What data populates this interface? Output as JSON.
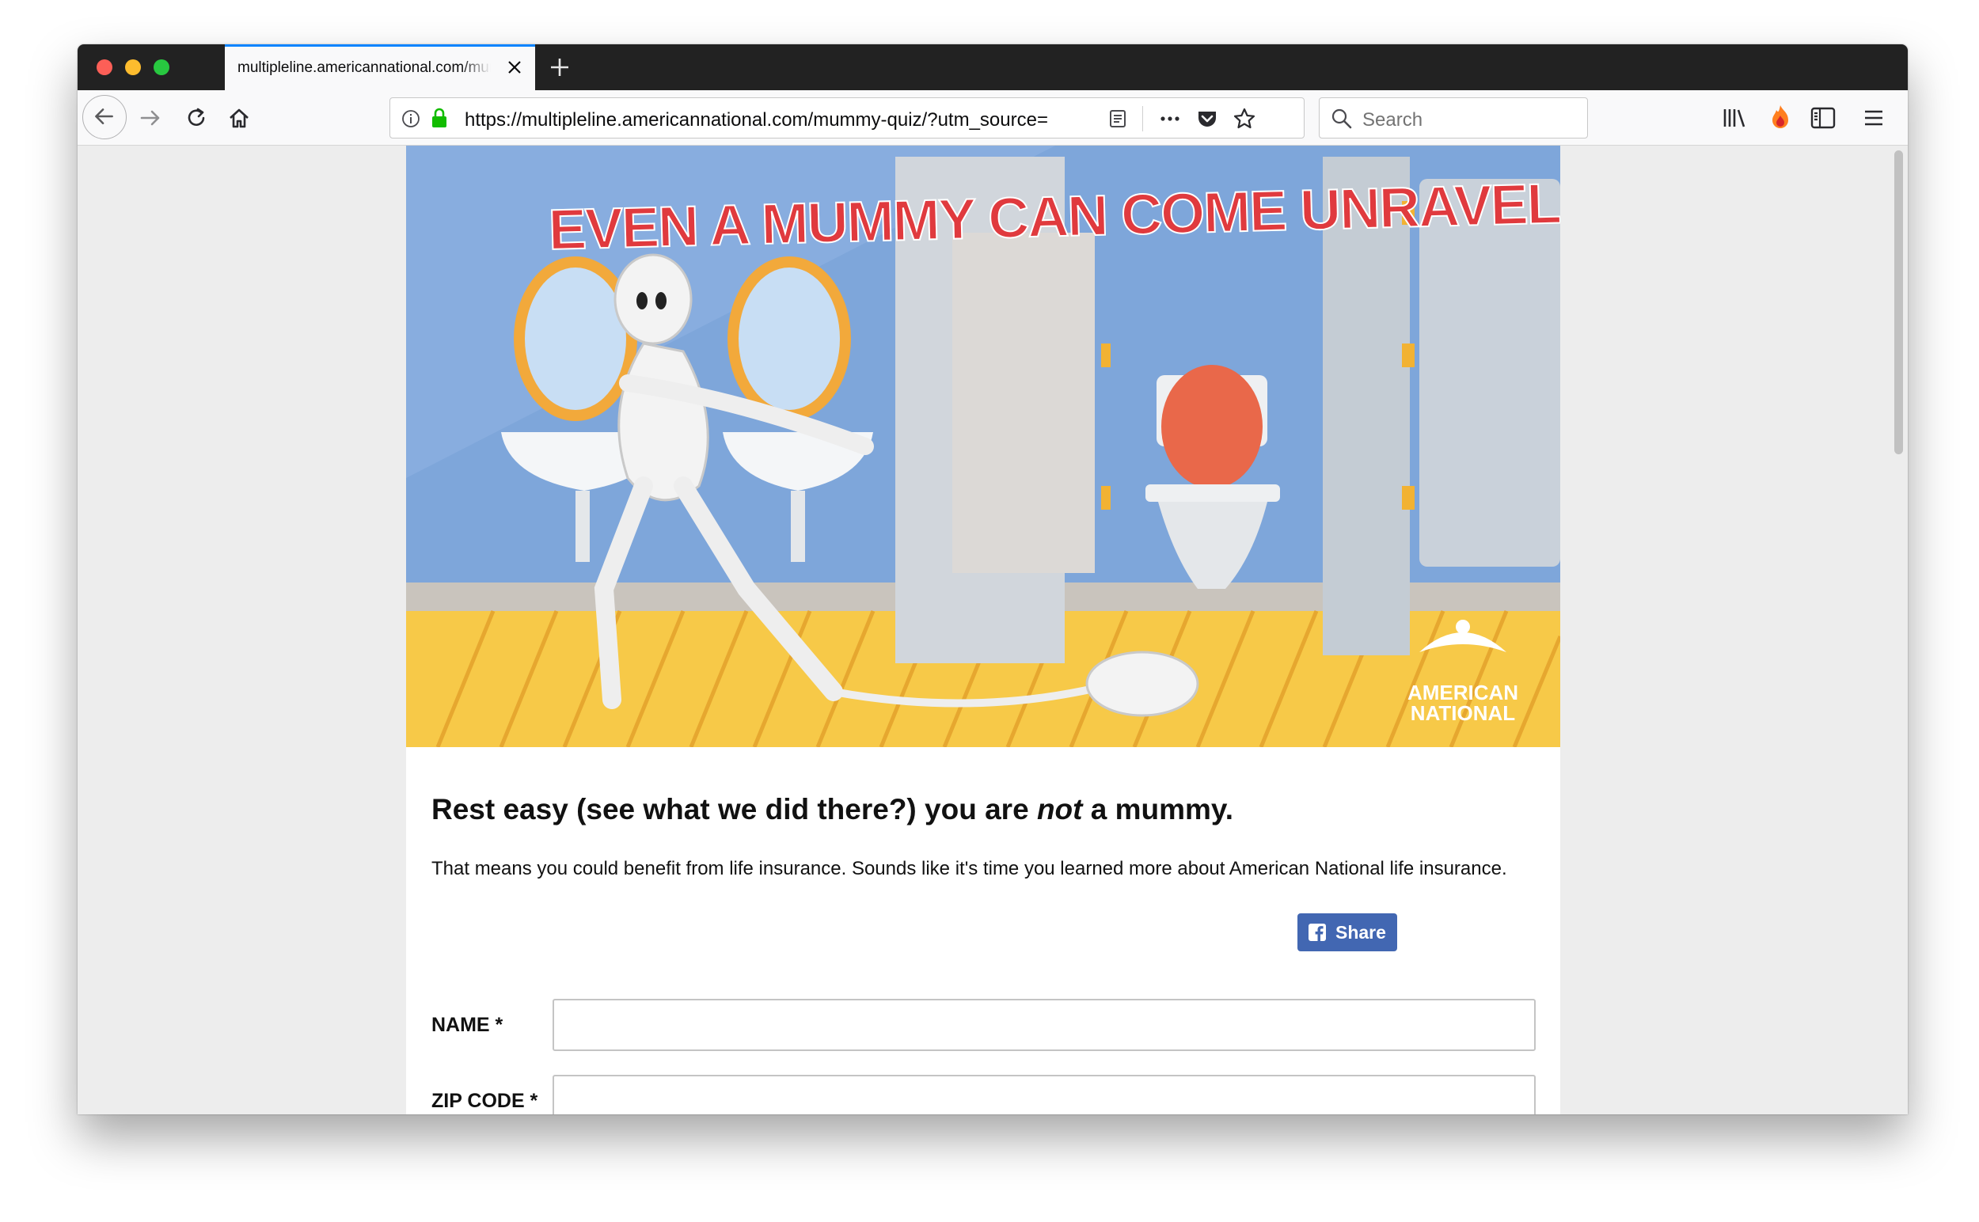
{
  "browser": {
    "tab_title": "multipleline.americannational.com/mummy-quiz/",
    "url": "https://multipleline.americannational.com/mummy-quiz/?utm_source=",
    "search_placeholder": "Search"
  },
  "hero": {
    "banner_text": "EVEN A MUMMY CAN COME UNRAVELED",
    "logo_line1": "AMERICAN",
    "logo_line2": "NATIONAL"
  },
  "result": {
    "headline_pre": "Rest easy (see what we did there?) you are ",
    "headline_em": "not",
    "headline_post": " a mummy.",
    "body": "That means you could benefit from life insurance. Sounds like it's time you learned more about American National life insurance.",
    "share_label": "Share"
  },
  "form": {
    "name_label": "NAME *",
    "zip_label": "ZIP CODE *"
  },
  "colors": {
    "accent_tab": "#0a84ff",
    "facebook_blue": "#4267b2",
    "banner_red": "#e03a3e",
    "floor_yellow": "#f7c948",
    "wall_blue": "#7ea6da"
  }
}
